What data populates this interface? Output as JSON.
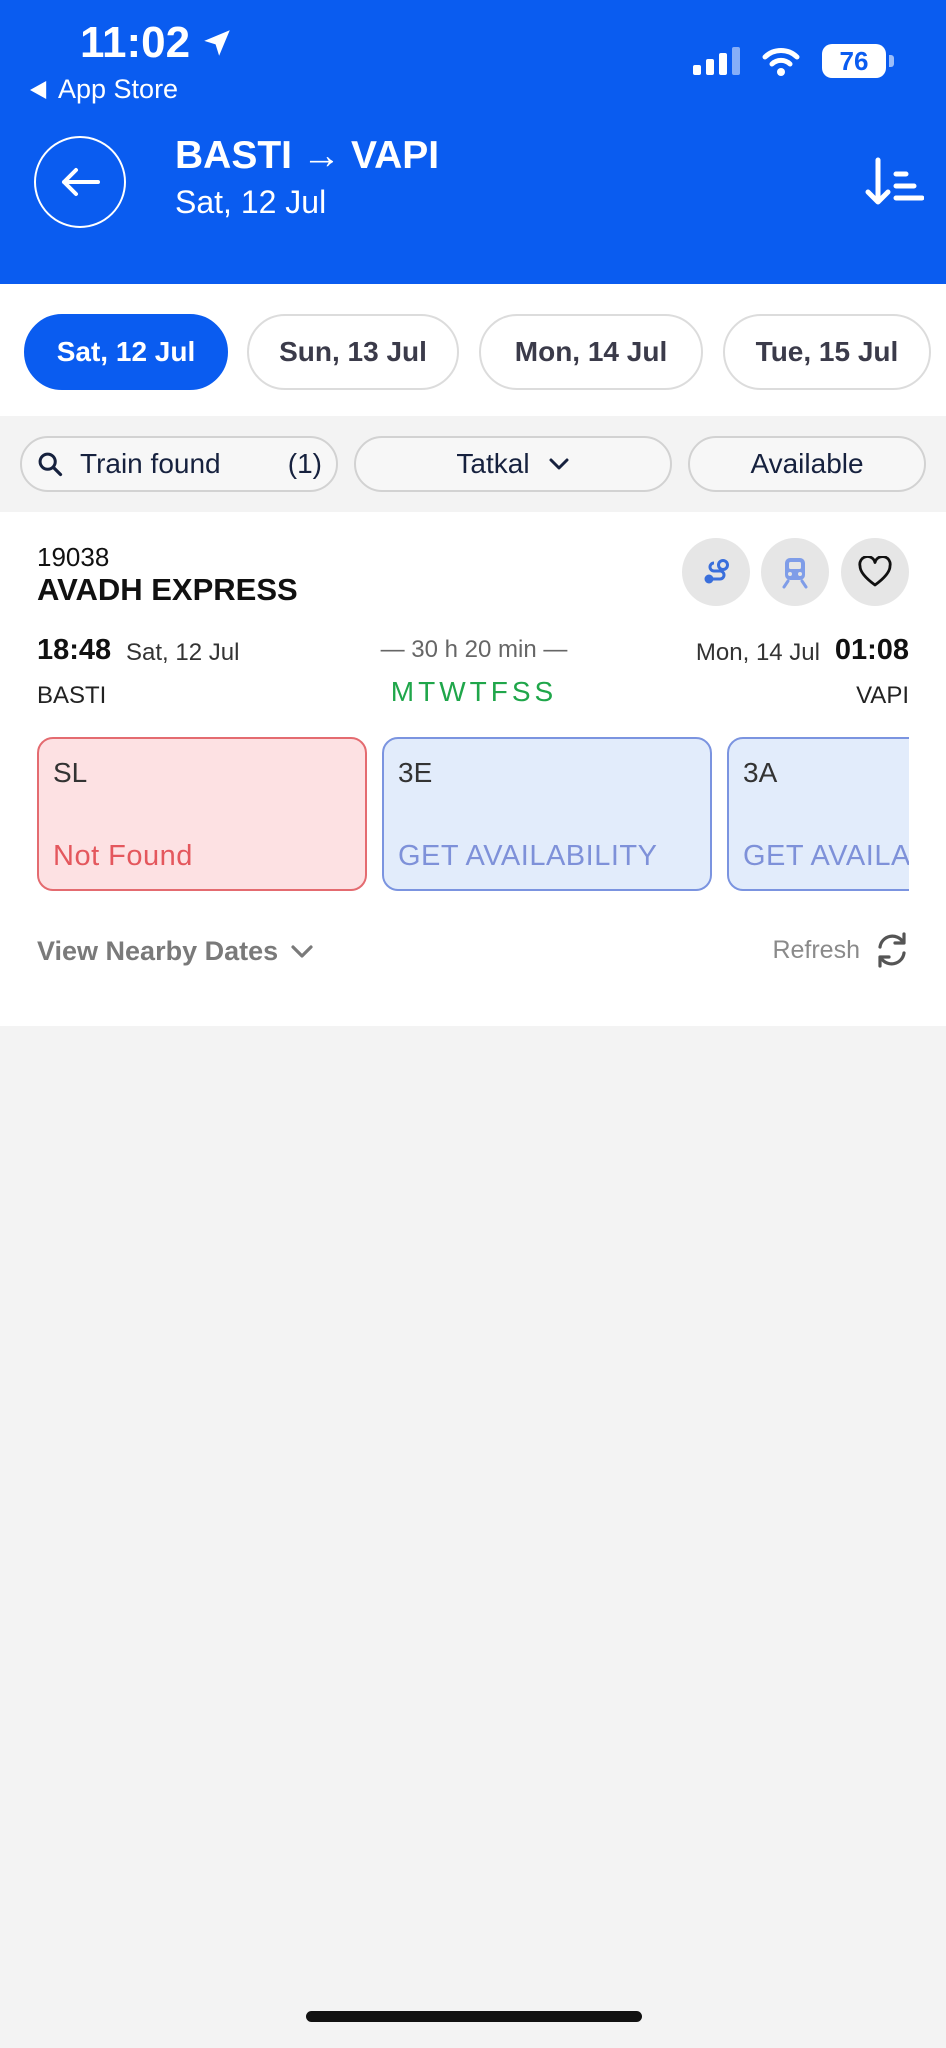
{
  "status_bar": {
    "time": "11:02",
    "back_app": "App Store",
    "battery": "76"
  },
  "header": {
    "from": "BASTI",
    "to": "VAPI",
    "arrow": "→",
    "date": "Sat, 12 Jul"
  },
  "dates": [
    {
      "label": "Sat, 12 Jul",
      "active": true
    },
    {
      "label": "Sun, 13 Jul",
      "active": false
    },
    {
      "label": "Mon, 14 Jul",
      "active": false
    },
    {
      "label": "Tue, 15 Jul",
      "active": false
    }
  ],
  "filters": {
    "search_label": "Train found",
    "search_count": "(1)",
    "quota": "Tatkal",
    "availability": "Available"
  },
  "train": {
    "number": "19038",
    "name": "AVADH EXPRESS",
    "dep_time": "18:48",
    "dep_date": "Sat, 12 Jul",
    "duration": "— 30 h 20 min —",
    "arr_date": "Mon, 14 Jul",
    "arr_time": "01:08",
    "from_station": "BASTI",
    "to_station": "VAPI",
    "run_days": "MTWTFSS",
    "classes": [
      {
        "code": "SL",
        "status": "Not Found"
      },
      {
        "code": "3E",
        "status": "GET AVAILABILITY"
      },
      {
        "code": "3A",
        "status": "GET AVAILABILITY"
      }
    ],
    "nearby_label": "View Nearby Dates",
    "refresh_label": "Refresh"
  },
  "colors": {
    "brand": "#0a5cf0",
    "run_days": "#1fa64a",
    "not_found": "#e4575d"
  },
  "icons": [
    "location-arrow-icon",
    "signal-icon",
    "wifi-icon",
    "battery-icon",
    "back-arrow-icon",
    "sort-icon",
    "search-icon",
    "chevron-down-icon",
    "route-icon",
    "train-icon",
    "heart-icon",
    "refresh-icon"
  ]
}
